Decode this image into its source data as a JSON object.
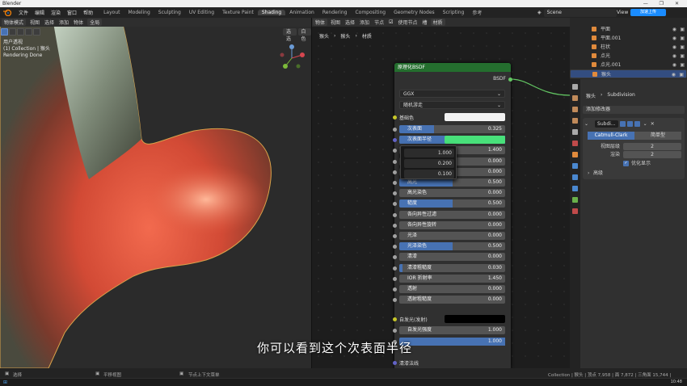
{
  "window": {
    "title": "Blender",
    "controls": "— ❐ ✕"
  },
  "menu": {
    "items": [
      "文件",
      "编辑",
      "渲染",
      "窗口",
      "帮助"
    ],
    "workspaces": [
      "Layout",
      "Modeling",
      "Sculpting",
      "UV Editing",
      "Texture Paint",
      "Shading",
      "Animation",
      "Rendering",
      "Compositing",
      "Geometry Nodes",
      "Scripting",
      "参考"
    ],
    "active_workspace": "Shading",
    "scene": "Scene",
    "view_layer": "View",
    "badge": "加速上传"
  },
  "viewport": {
    "mode": "物体模式",
    "menu": [
      "视图",
      "选择",
      "添加",
      "物体"
    ],
    "transform": "全局",
    "info_lines": [
      "用户透视",
      "(1) Collection | 猴头",
      "Rendering Done"
    ],
    "slot_dropdown": "选选",
    "world_dropdown": "白色"
  },
  "node_editor": {
    "header": [
      "物体",
      "视图",
      "选择",
      "添加",
      "节点"
    ],
    "use_nodes": "使用节点",
    "slot": "槽",
    "material": "材质",
    "breadcrumb": [
      "猴头",
      "猴头",
      "材质"
    ],
    "node": {
      "title": "原理化BSDF",
      "output": "BSDF",
      "distribution": "GGX",
      "subsurface_method": "随机游走",
      "base_color_label": "基础色",
      "base_color": "#f2f2f2",
      "subsurface_color": "#48e07a",
      "rows": [
        {
          "name": "次表面",
          "value": "0.325",
          "fill": 0.33
        },
        {
          "name": "次表面半径",
          "value": "",
          "fill": 1.0
        },
        {
          "name": "",
          "value": "1.400",
          "fill": 0
        },
        {
          "name": "",
          "value": "0.000",
          "fill": 0
        },
        {
          "name": "金属度",
          "value": "0.000",
          "fill": 0
        },
        {
          "name": "高光",
          "value": "0.500",
          "fill": 0.5
        },
        {
          "name": "高光染色",
          "value": "0.000",
          "fill": 0
        },
        {
          "name": "糙度",
          "value": "0.500",
          "fill": 0.5
        },
        {
          "name": "各向异性过滤",
          "value": "0.000",
          "fill": 0
        },
        {
          "name": "各向异性旋转",
          "value": "0.000",
          "fill": 0
        },
        {
          "name": "光泽",
          "value": "0.000",
          "fill": 0
        },
        {
          "name": "光泽染色",
          "value": "0.500",
          "fill": 0.5
        },
        {
          "name": "清漆",
          "value": "0.000",
          "fill": 0
        },
        {
          "name": "清漆粗糙度",
          "value": "0.030",
          "fill": 0.03
        },
        {
          "name": "IOR 折射率",
          "value": "1.450",
          "fill": 0
        },
        {
          "name": "透射",
          "value": "0.000",
          "fill": 0
        },
        {
          "name": "透射粗糙度",
          "value": "0.000",
          "fill": 0
        }
      ],
      "emission_label": "自发光(发射)",
      "emission_color": "#000000",
      "emission_strength_label": "自发光强度",
      "emission_strength": "1.000",
      "alpha_value": "1.000",
      "clearcoat_normal": "清漆法线",
      "alpha_fill": 1.0
    },
    "radius_popup": [
      "1.000",
      "0.200",
      "0.100"
    ],
    "subtitle": "你可以看到这个次表面半径"
  },
  "outliner": {
    "rows": [
      "平面",
      "平面.001",
      "柱状",
      "点光",
      "点光.001",
      "猴头"
    ],
    "selected": 5
  },
  "properties": {
    "breadcrumb": [
      "猴头",
      "Subdivision"
    ],
    "add_modifier": "添加修改器",
    "modifier_name": "Subdi...",
    "methods": [
      "Catmull-Clark",
      "简单型"
    ],
    "active_method": 0,
    "levels_label": "视图层级",
    "levels": "2",
    "render_label": "渲染",
    "render": "2",
    "optimal_label": "优化显示",
    "advanced": "高级"
  },
  "status": {
    "left": "选择",
    "mid": "平移视图",
    "right_hint": "节点上下文菜单",
    "stats": "Collection | 猴头 | 顶点 7,958 | 面 7,872 | 三角面 15,744 |",
    "time": "10:48"
  },
  "colors": {
    "accent": "#4772b3",
    "node_header": "#246e2e",
    "selection": "#334d80"
  }
}
